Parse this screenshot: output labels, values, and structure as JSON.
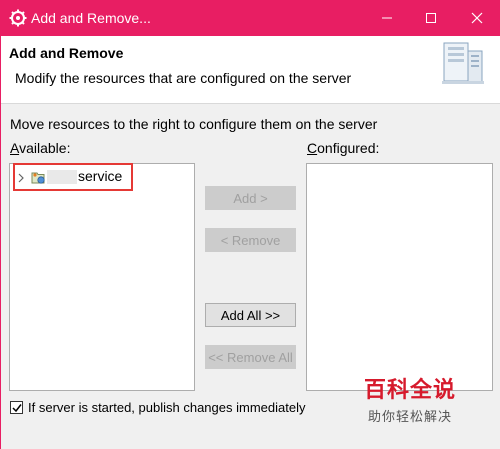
{
  "window": {
    "title": "Add and Remove...",
    "title_color": "#e81e63"
  },
  "banner": {
    "heading": "Add and Remove",
    "description": "Modify the resources that are configured on the server"
  },
  "main": {
    "instruction": "Move resources to the right to configure them on the server",
    "available": {
      "label_prefix": "A",
      "label_rest": "vailable:",
      "items": [
        {
          "label": "service",
          "icon": "java-project-icon"
        }
      ]
    },
    "configured": {
      "label_prefix": "C",
      "label_rest": "onfigured:",
      "items": []
    },
    "buttons": {
      "add": "Add >",
      "remove": "< Remove",
      "add_all": "Add All >>",
      "remove_all": "<< Remove All"
    },
    "publish_checkbox": {
      "checked": true,
      "label": "If server is started, publish changes immediately"
    }
  },
  "watermark": {
    "main": "百科全说",
    "sub": "助你轻松解决"
  }
}
